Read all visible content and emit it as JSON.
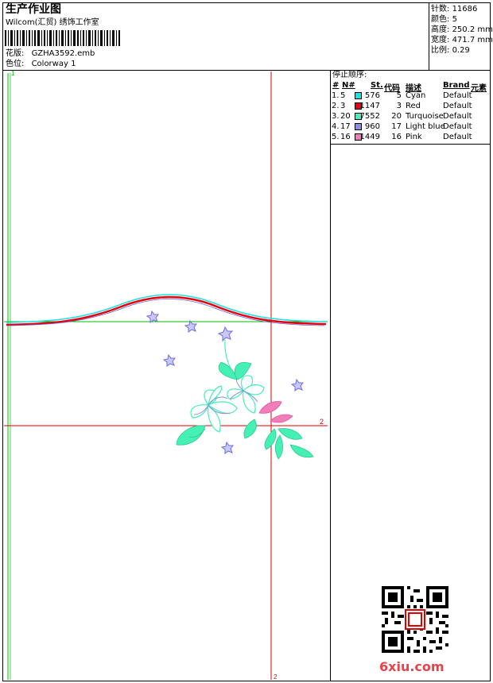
{
  "header": {
    "title": "生产作业图",
    "company": "Wilcom(汇贸) 绣饰工作室",
    "design_label": "花版:",
    "design_value": "GZHA3592.emb",
    "colorway_label": "色位:",
    "colorway_value": "Colorway 1"
  },
  "stats": [
    {
      "label": "针数:",
      "value": "11686"
    },
    {
      "label": "颜色:",
      "value": "5"
    },
    {
      "label": "高度:",
      "value": "250.2 mm"
    },
    {
      "label": "宽度:",
      "value": "471.7 mm"
    },
    {
      "label": "比例:",
      "value": "0.29"
    }
  ],
  "stop_sequence": {
    "title": "停止顺序:",
    "headers": {
      "num": "#",
      "needle": "N#",
      "stitches": "St.",
      "code": "代码",
      "desc": "描述",
      "brand": "Brand",
      "element": "元素"
    },
    "rows": [
      {
        "num": "1.",
        "needle": "5",
        "color": "#19E2E2",
        "stitches": "576",
        "code": "5",
        "desc": "Cyan",
        "brand": "Default"
      },
      {
        "num": "2.",
        "needle": "3",
        "color": "#E8000C",
        "stitches": "1147",
        "code": "3",
        "desc": "Red",
        "brand": "Default"
      },
      {
        "num": "3.",
        "needle": "20",
        "color": "#45F0B4",
        "stitches": "7552",
        "code": "20",
        "desc": "Turquoise",
        "brand": "Default"
      },
      {
        "num": "4.",
        "needle": "17",
        "color": "#8C8CEA",
        "stitches": "960",
        "code": "17",
        "desc": "Light blue",
        "brand": "Default"
      },
      {
        "num": "5.",
        "needle": "16",
        "color": "#F27DB9",
        "stitches": "1449",
        "code": "16",
        "desc": "Pink",
        "brand": "Default"
      }
    ]
  },
  "canvas": {
    "hoop_label_top": "1",
    "hoop_label_right": "2",
    "hoop_label_bottom": "2"
  },
  "watermark": {
    "text": "6xiu.com"
  },
  "colors": {
    "guide_green": "#00C000",
    "guide_red": "#E00000",
    "cyan": "#19E2E2",
    "red": "#E8000C",
    "turquoise": "#45F0B4",
    "lightblue": "#8C8CEA",
    "pink": "#F27DB9"
  }
}
